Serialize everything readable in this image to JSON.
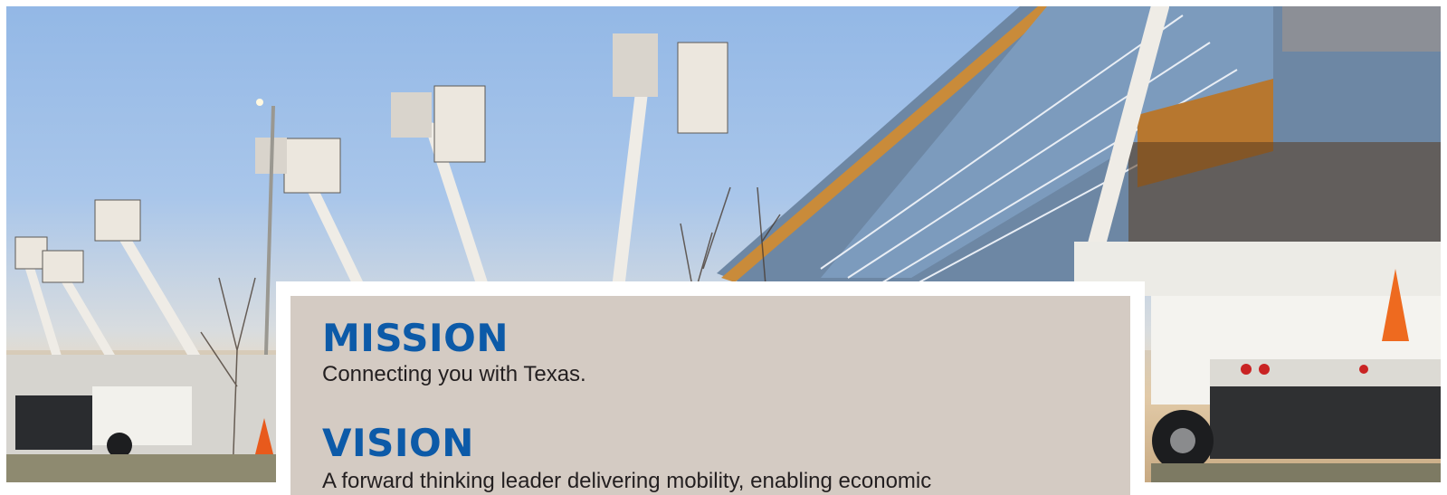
{
  "mission": {
    "heading": "MISSION",
    "statement": "Connecting you with Texas."
  },
  "vision": {
    "heading": "VISION",
    "statement": "A forward thinking leader delivering mobility, enabling economic"
  },
  "colors": {
    "heading": "#0c5aa8",
    "card_background": "#d4cbc3",
    "body_text": "#231f20",
    "sky": "#93b8e6"
  },
  "images": {
    "hero": "photo-bucket-trucks-at-building"
  }
}
